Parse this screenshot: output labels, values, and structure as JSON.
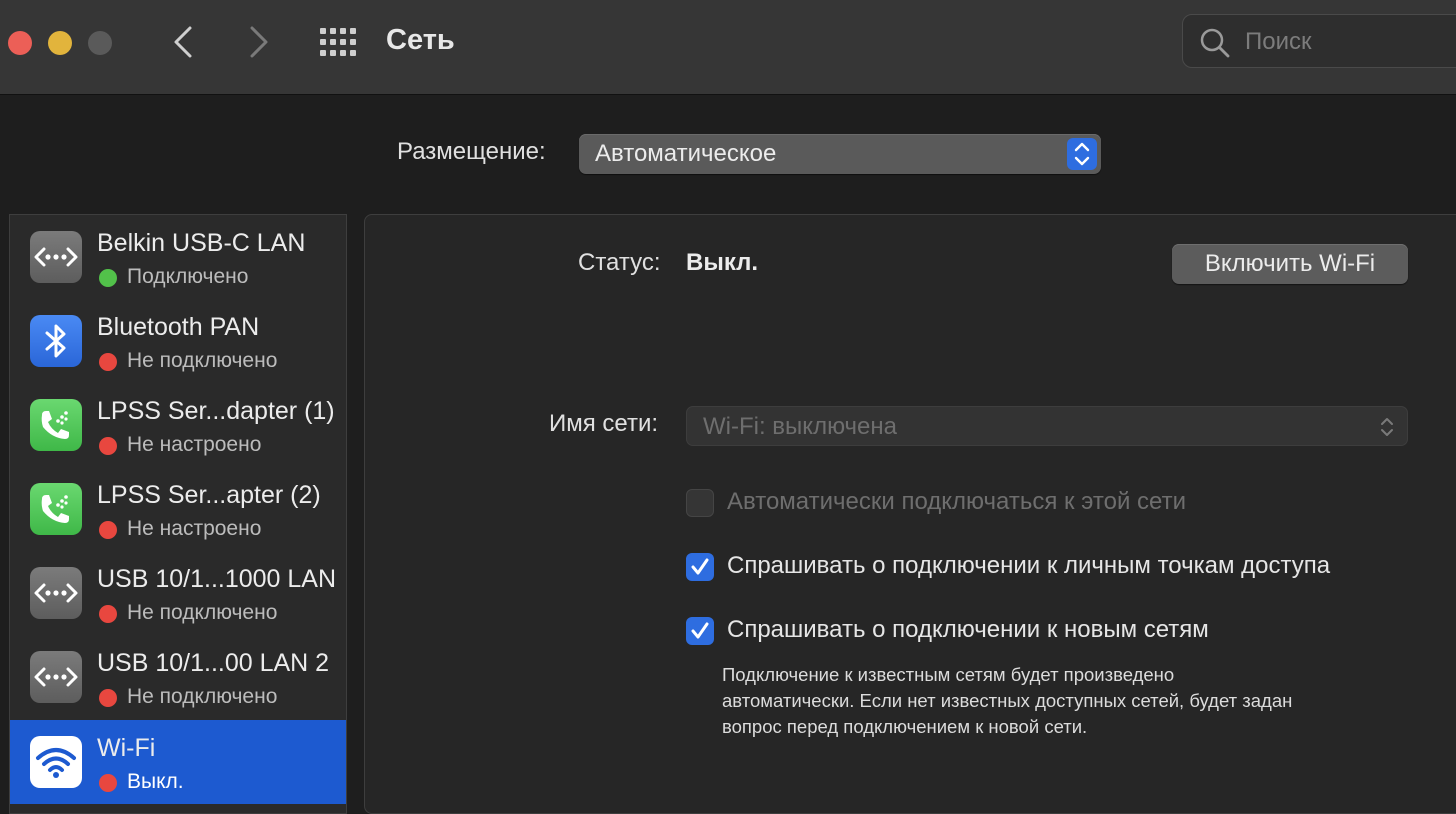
{
  "window": {
    "title": "Сеть",
    "search_placeholder": "Поиск"
  },
  "location": {
    "label": "Размещение:",
    "value": "Автоматическое"
  },
  "sidebar": {
    "items": [
      {
        "name": "Belkin USB-C LAN",
        "status": "Подключено",
        "status_color": "#52c14a",
        "icon": "ethernet-icon"
      },
      {
        "name": "Bluetooth PAN",
        "status": "Не подключено",
        "status_color": "#e8473f",
        "icon": "bluetooth-icon"
      },
      {
        "name": "LPSS Ser...dapter (1)",
        "status": "Не настроено",
        "status_color": "#e8473f",
        "icon": "modem-phone-icon"
      },
      {
        "name": "LPSS Ser...apter (2)",
        "status": "Не настроено",
        "status_color": "#e8473f",
        "icon": "modem-phone-icon"
      },
      {
        "name": "USB 10/1...1000 LAN",
        "status": "Не подключено",
        "status_color": "#e8473f",
        "icon": "ethernet-icon"
      },
      {
        "name": "USB 10/1...00 LAN 2",
        "status": "Не подключено",
        "status_color": "#e8473f",
        "icon": "ethernet-icon"
      },
      {
        "name": "Wi-Fi",
        "status": "Выкл.",
        "status_color": "#e8473f",
        "icon": "wifi-icon",
        "selected": true
      }
    ]
  },
  "detail": {
    "status_label": "Статус:",
    "status_value": "Выкл.",
    "toggle_button": "Включить Wi-Fi",
    "network_name_label": "Имя сети:",
    "network_name_value": "Wi-Fi: выключена",
    "checkboxes": [
      {
        "label": "Автоматически подключаться к этой сети",
        "checked": false,
        "enabled": false
      },
      {
        "label": "Спрашивать о подключении к личным точкам доступа",
        "checked": true,
        "enabled": true
      },
      {
        "label": "Спрашивать о подключении к новым сетям",
        "checked": true,
        "enabled": true
      }
    ],
    "note_lines": [
      "Подключение к известным сетям будет произведено",
      "автоматически. Если нет известных доступных сетей, будет задан",
      "вопрос перед подключением к новой сети."
    ]
  },
  "colors": {
    "accent": "#2e6de0",
    "selection": "#1d5ad0",
    "status_green": "#52c14a",
    "status_red": "#e8473f"
  }
}
